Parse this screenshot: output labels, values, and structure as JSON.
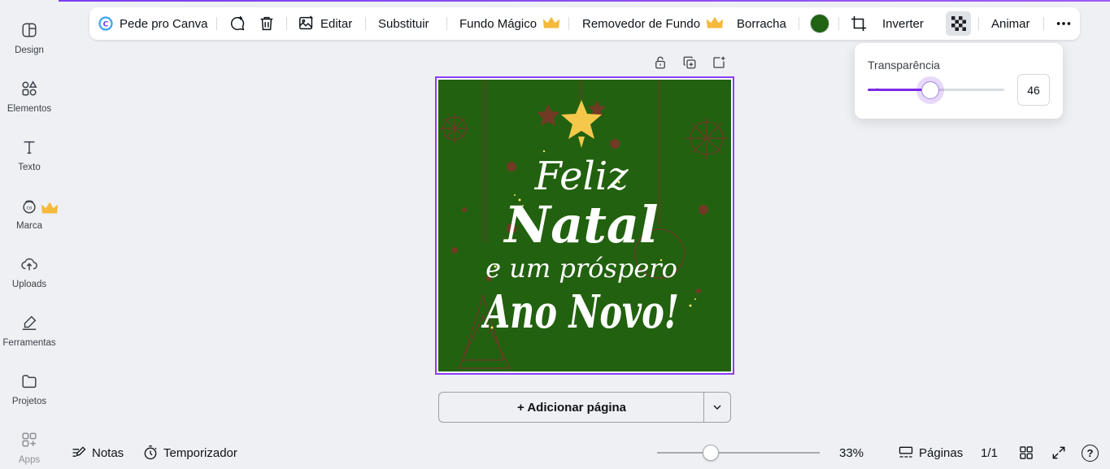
{
  "sidebar": {
    "items": [
      {
        "label": "Design",
        "icon": "design-icon"
      },
      {
        "label": "Elementos",
        "icon": "shapes-icon"
      },
      {
        "label": "Texto",
        "icon": "text-icon"
      },
      {
        "label": "Marca",
        "icon": "brand-icon"
      },
      {
        "label": "Uploads",
        "icon": "upload-cloud-icon"
      },
      {
        "label": "Ferramentas",
        "icon": "pen-tool-icon"
      },
      {
        "label": "Projetos",
        "icon": "folder-icon"
      },
      {
        "label": "Apps",
        "icon": "apps-icon"
      }
    ]
  },
  "toolbar": {
    "ask_canva": "Pede pro Canva",
    "edit": "Editar",
    "replace": "Substituir",
    "magic_bg": "Fundo Mágico",
    "bg_remover": "Removedor de Fundo",
    "eraser": "Borracha",
    "flip": "Inverter",
    "animate": "Animar",
    "color": "#1f6313",
    "accent": "#8b3dff",
    "premium_color": "#f5b93b"
  },
  "transparency": {
    "label": "Transparência",
    "value": "46",
    "fraction": 0.46
  },
  "design": {
    "line1": "Feliz",
    "line2": "Natal",
    "line3": "e um próspero",
    "line4": "Ano Novo!",
    "background": "#22610f"
  },
  "add_page": "+ Adicionar página",
  "bottom": {
    "notes": "Notas",
    "timer": "Temporizador",
    "zoom": "33%",
    "zoom_fraction": 0.33,
    "pages_label": "Páginas",
    "pages_count": "1/1",
    "help": "?"
  }
}
